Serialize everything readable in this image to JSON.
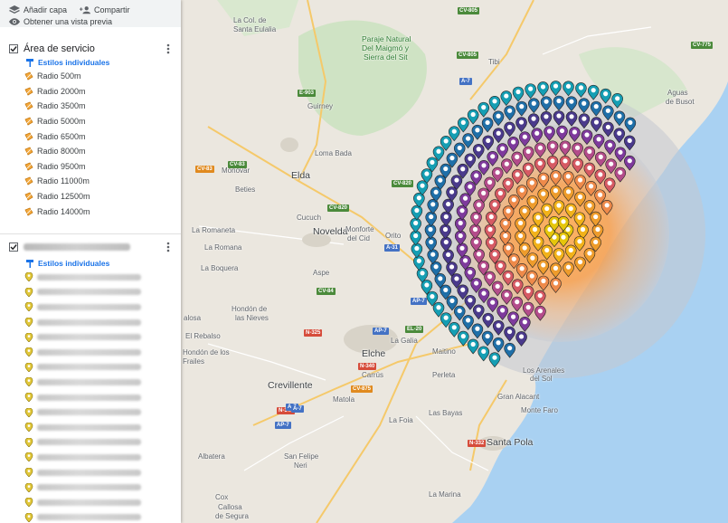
{
  "toolbar": {
    "add_layer": "Añadir capa",
    "share": "Compartir",
    "preview": "Obtener una vista previa"
  },
  "layer1": {
    "title": "Área de servicio",
    "styles": "Estilos individuales",
    "items": [
      "Radio 500m",
      "Radio 2000m",
      "Radio 3500m",
      "Radio 5000m",
      "Radio 6500m",
      "Radio 8000m",
      "Radio 9500m",
      "Radio 11000m",
      "Radio 12500m",
      "Radio 14000m"
    ]
  },
  "layer2": {
    "styles": "Estilos individuales",
    "item_count": 17
  },
  "colors": {
    "radius_icon": "#f4a93b",
    "place_icon": "#e2c83b",
    "link_blue": "#1a73e8",
    "water": "#a9d1f2",
    "land": "#e9e5dc",
    "heat_core": "#ff9a3c",
    "marker_rings": [
      "#e6c60b",
      "#f2b21a",
      "#ee9c2c",
      "#ee8a4a",
      "#d65a63",
      "#b34c8a",
      "#7e3a9c",
      "#4a3a8c",
      "#1f6fa8",
      "#159eb3"
    ]
  },
  "map": {
    "labels": [
      {
        "t": "La Col. de",
        "cls": ""
      },
      {
        "t": "Santa Eulalia",
        "cls": ""
      },
      {
        "t": "Paraje Natural",
        "cls": "park"
      },
      {
        "t": "Del Maigmó y",
        "cls": "park"
      },
      {
        "t": "Sierra del Sit",
        "cls": "park"
      },
      {
        "t": "Tibi",
        "cls": ""
      },
      {
        "t": "Aguas",
        "cls": ""
      },
      {
        "t": "de Busot",
        "cls": ""
      },
      {
        "t": "Elda",
        "cls": "city"
      },
      {
        "t": "Guirney",
        "cls": ""
      },
      {
        "t": "Loma Bada",
        "cls": ""
      },
      {
        "t": "Monóvar",
        "cls": ""
      },
      {
        "t": "Beties",
        "cls": ""
      },
      {
        "t": "Cucuch",
        "cls": ""
      },
      {
        "t": "Novelda",
        "cls": "city"
      },
      {
        "t": "Monforte",
        "cls": ""
      },
      {
        "t": "del Cid",
        "cls": ""
      },
      {
        "t": "Orito",
        "cls": ""
      },
      {
        "t": "La Romaneta",
        "cls": ""
      },
      {
        "t": "La Romana",
        "cls": ""
      },
      {
        "t": "La Boquera",
        "cls": ""
      },
      {
        "t": "Aspe",
        "cls": ""
      },
      {
        "t": "Hondón de",
        "cls": ""
      },
      {
        "t": "las Nieves",
        "cls": ""
      },
      {
        "t": "alosa",
        "cls": ""
      },
      {
        "t": "El Rebalso",
        "cls": ""
      },
      {
        "t": "Hondón de los",
        "cls": ""
      },
      {
        "t": "Frailes",
        "cls": ""
      },
      {
        "t": "La Galia",
        "cls": ""
      },
      {
        "t": "Elche",
        "cls": "city"
      },
      {
        "t": "Maitino",
        "cls": ""
      },
      {
        "t": "Carrús",
        "cls": ""
      },
      {
        "t": "Perleta",
        "cls": ""
      },
      {
        "t": "Crevillente",
        "cls": "city"
      },
      {
        "t": "Matola",
        "cls": ""
      },
      {
        "t": "Gran Alacant",
        "cls": ""
      },
      {
        "t": "Las Bayas",
        "cls": ""
      },
      {
        "t": "Monte Faro",
        "cls": ""
      },
      {
        "t": "La Foia",
        "cls": ""
      },
      {
        "t": "Albatera",
        "cls": ""
      },
      {
        "t": "San Felipe",
        "cls": ""
      },
      {
        "t": "Neri",
        "cls": ""
      },
      {
        "t": "Santa Pola",
        "cls": "city"
      },
      {
        "t": "Cox",
        "cls": ""
      },
      {
        "t": "Callosa",
        "cls": ""
      },
      {
        "t": "de Segura",
        "cls": ""
      },
      {
        "t": "La Marina",
        "cls": ""
      },
      {
        "t": "Los Arenales",
        "cls": ""
      },
      {
        "t": "del Sol",
        "cls": ""
      }
    ],
    "shields": [
      "CV-805",
      "CV-805",
      "CV-775",
      "A-7",
      "E-903",
      "CV-83",
      "CV-83",
      "CV-820",
      "CV-820",
      "A-31",
      "CV-84",
      "AP-7",
      "AP-7",
      "EL-20",
      "N-325",
      "N-340",
      "N-340",
      "CV-875",
      "A-7",
      "AP-7",
      "N-332",
      "A-7"
    ]
  }
}
